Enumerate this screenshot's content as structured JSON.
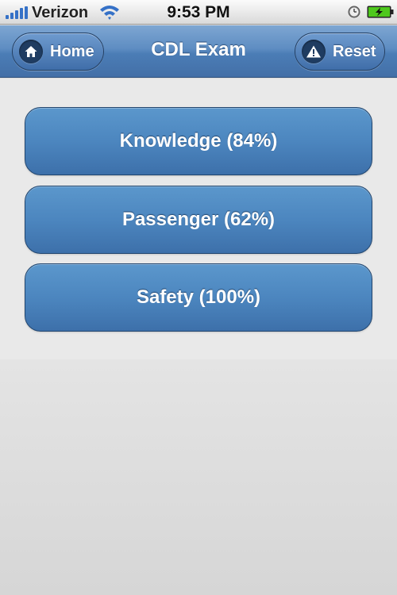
{
  "status_bar": {
    "carrier": "Verizon",
    "time": "9:53 PM",
    "signal_icon": "signal-bars-icon",
    "wifi_icon": "wifi-icon",
    "clock_icon": "clock-icon",
    "battery_icon": "battery-charging-icon"
  },
  "nav": {
    "title": "CDL Exam",
    "home_label": "Home",
    "reset_label": "Reset",
    "home_icon": "home-icon",
    "reset_icon": "warning-icon"
  },
  "quizzes": [
    {
      "label": "Knowledge (84%)"
    },
    {
      "label": "Passenger (62%)"
    },
    {
      "label": "Safety (100%)"
    }
  ],
  "colors": {
    "nav_bar": "#5e8dc2",
    "button": "#4c86bf",
    "battery_green": "#4ec81d"
  }
}
